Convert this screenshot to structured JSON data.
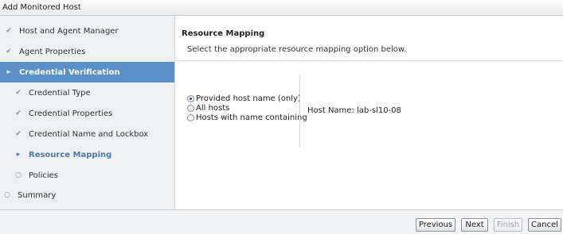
{
  "window": {
    "title": "Add Monitored Host"
  },
  "sidebar": {
    "items": [
      {
        "label": "Host and Agent Manager",
        "icon": "check-icon",
        "glyph": "✔"
      },
      {
        "label": "Agent Properties",
        "icon": "check-icon",
        "glyph": "✔"
      },
      {
        "label": "Credential Verification",
        "icon": "triangle-right-icon",
        "glyph": "▸"
      },
      {
        "label": "Credential Type",
        "icon": "check-icon",
        "glyph": "✔"
      },
      {
        "label": "Credential Properties",
        "icon": "check-icon",
        "glyph": "✔"
      },
      {
        "label": "Credential Name and Lockbox",
        "icon": "check-icon",
        "glyph": "✔"
      },
      {
        "label": "Resource Mapping",
        "icon": "triangle-right-icon",
        "glyph": "▸"
      },
      {
        "label": "Policies",
        "icon": "circle-icon",
        "glyph": "○"
      },
      {
        "label": "Summary",
        "icon": "circle-icon",
        "glyph": "○"
      }
    ]
  },
  "main": {
    "title": "Resource Mapping",
    "description": "Select the appropriate resource mapping option below.",
    "options": [
      {
        "label": "Provided host name (only)",
        "checked": true
      },
      {
        "label": "All hosts",
        "checked": false
      },
      {
        "label": "Hosts with name containing",
        "checked": false
      }
    ],
    "host_name": "Host Name: lab-sl10-08"
  },
  "footer": {
    "previous": "Previous",
    "next": "Next",
    "finish": "Finish",
    "cancel": "Cancel"
  },
  "colors": {
    "active_bg": "#5b8fc7",
    "current_text": "#4a79b0"
  }
}
